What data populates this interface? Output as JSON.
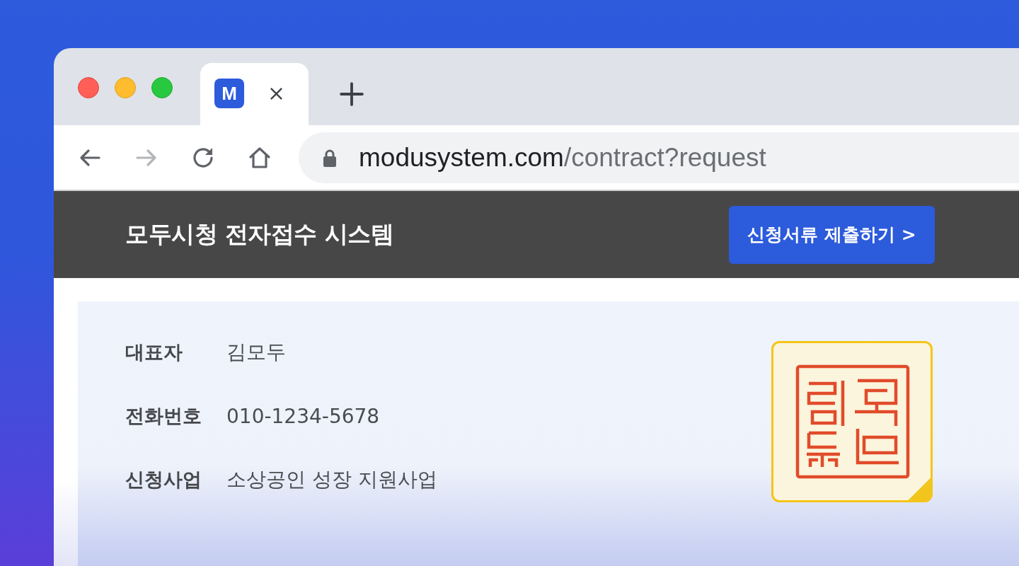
{
  "browser": {
    "tabs": [
      {
        "favicon": "M",
        "selected": true
      }
    ],
    "nav_buttons": [
      {
        "kind": "back",
        "disabled": false
      },
      {
        "kind": "forward",
        "disabled": true
      },
      {
        "kind": "reload",
        "disabled": false
      },
      {
        "kind": "home",
        "disabled": false
      }
    ],
    "address_bar": {
      "host": "modusystem.com",
      "path": "/contract?request"
    }
  },
  "page": {
    "header": {
      "title": "모두시청 전자접수 시스템",
      "button": "신청서류 제출하기 >"
    },
    "fields": [
      {
        "label": "대표자",
        "value": "김모두"
      },
      {
        "label": "전화번호",
        "value": "010-1234-5678"
      },
      {
        "label": "신청사업",
        "value": "소상공인 성장 지원사업"
      }
    ]
  }
}
